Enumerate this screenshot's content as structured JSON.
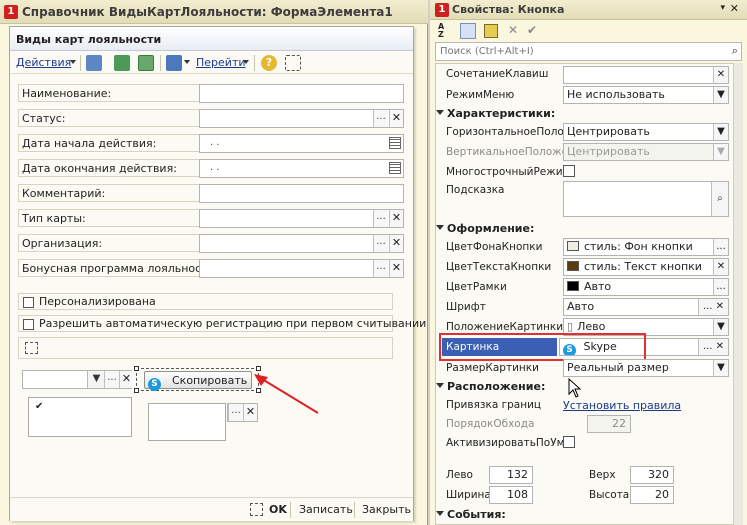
{
  "designer": {
    "title": "Справочник ВидыКартЛояльности: ФормаЭлемента1",
    "form_title": "Виды карт лояльности",
    "cmd": {
      "actions": "Действия",
      "goto": "Перейти"
    },
    "fields": {
      "name": "Наименование:",
      "status": "Статус:",
      "start": "Дата начала действия:",
      "end": "Дата окончания действия:",
      "comment": "Комментарий:",
      "card_type": "Тип карты:",
      "org": "Организация:",
      "bonus": "Бонусная программа лояльности:"
    },
    "date_placeholder": ". .",
    "checks": {
      "personal": "Персонализирована",
      "autoreg": "Разрешить автоматическую регистрацию при первом считывании"
    },
    "copy_button": "Скопировать",
    "check_mark": "✔",
    "status_bar": {
      "ok": "OK",
      "save": "Записать",
      "close": "Закрыть"
    }
  },
  "props": {
    "title": "Свойства: Кнопка",
    "search_placeholder": "Поиск (Ctrl+Alt+I)",
    "shortcut_label": "СочетаниеКлавиш",
    "mode_label": "РежимМеню",
    "mode_value": "Не использовать",
    "groups": {
      "characteristics": "Характеристики:",
      "design": "Оформление:",
      "location": "Расположение:",
      "events": "События:"
    },
    "horiz_label": "ГоризонтальноеПоложе",
    "horiz_value": "Центрировать",
    "vert_label": "ВертикальноеПоложе",
    "vert_value": "Центрировать",
    "multiline_label": "МногострочныйРежим",
    "hint_label": "Подсказка",
    "bg_label": "ЦветФонаКнопки",
    "bg_value": "стиль: Фон кнопки",
    "textcolor_label": "ЦветТекстаКнопки",
    "textcolor_value": "стиль: Текст кнопки",
    "border_label": "ЦветРамки",
    "border_value": "Авто",
    "font_label": "Шрифт",
    "font_value": "Авто",
    "picpos_label": "ПоложениеКартинки",
    "picpos_value": "Лево",
    "picture_label": "Картинка",
    "picture_value": "Skype",
    "picsize_label": "РазмерКартинки",
    "picsize_value": "Реальный размер",
    "anchor_label": "Привязка границ",
    "anchor_link": "Установить правила",
    "taborder_label": "ПорядокОбхода",
    "taborder_value": "22",
    "activate_label": "АктивизироватьПоУм",
    "left_label": "Лево",
    "left_value": "132",
    "top_label": "Верх",
    "top_value": "320",
    "width_label": "Ширина",
    "width_value": "108",
    "height_label": "Высота",
    "height_value": "20"
  },
  "colors": {
    "highlight_border": "#e03030",
    "selected_row": "#3b5fb5",
    "arrow": "#e02020"
  },
  "icons": [
    "app-1c-icon",
    "save-icon",
    "refresh-icon",
    "copy-icon",
    "navigate-icon",
    "help-icon",
    "skype-icon",
    "sort-icon",
    "search-icon",
    "close-icon"
  ]
}
